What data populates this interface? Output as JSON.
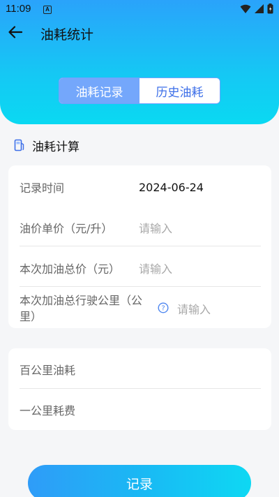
{
  "status_bar": {
    "time": "11:09",
    "notification_letter": "A"
  },
  "topbar": {
    "title": "油耗统计"
  },
  "tabs": [
    {
      "label": "油耗记录",
      "active": true
    },
    {
      "label": "历史油耗",
      "active": false
    }
  ],
  "section": {
    "title": "油耗计算"
  },
  "form": {
    "record_time": {
      "label": "记录时间",
      "value": "2024-06-24"
    },
    "unit_price": {
      "label": "油价单价（元/升）",
      "placeholder": "请输入"
    },
    "total_price": {
      "label": "本次加油总价（元）",
      "placeholder": "请输入"
    },
    "total_km": {
      "label": "本次加油总行驶公里（公里）",
      "placeholder": "请输入"
    }
  },
  "results": {
    "per_100km": {
      "label": "百公里油耗"
    },
    "per_km_cost": {
      "label": "一公里耗费"
    }
  },
  "actions": {
    "record_label": "记录"
  },
  "colors": {
    "accent": "#2aa3fb",
    "tab_active": "#74a7fb",
    "tab_text": "#3d6fe8"
  }
}
